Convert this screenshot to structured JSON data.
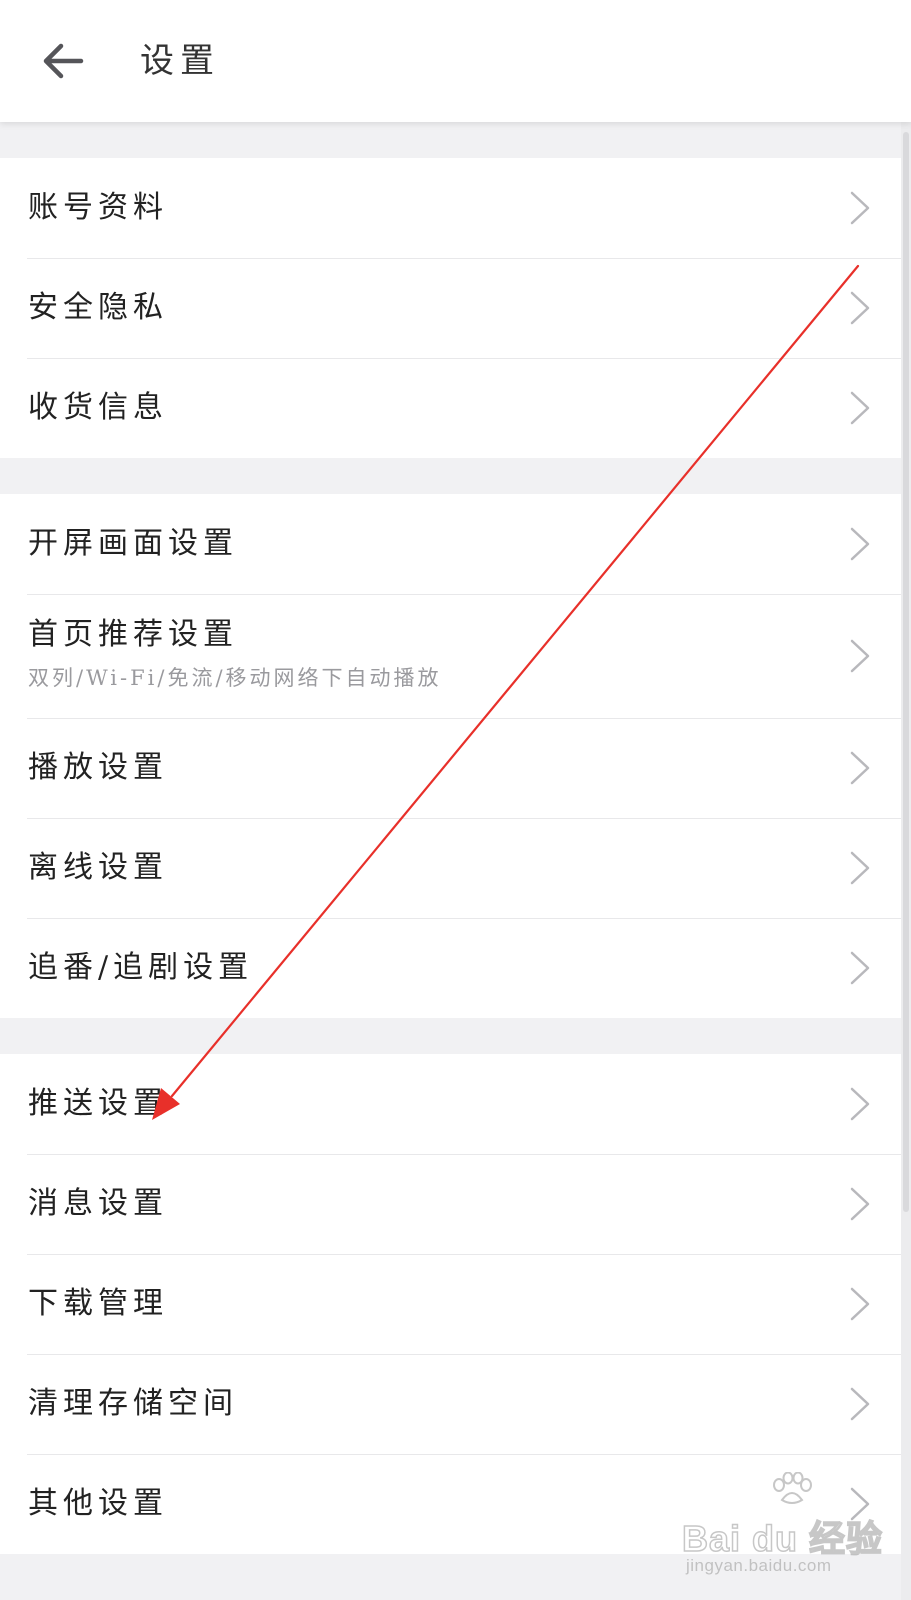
{
  "header": {
    "title": "设置"
  },
  "groups": [
    {
      "items": [
        {
          "label": "账号资料"
        },
        {
          "label": "安全隐私"
        },
        {
          "label": "收货信息"
        }
      ]
    },
    {
      "items": [
        {
          "label": "开屏画面设置"
        },
        {
          "label": "首页推荐设置",
          "sub": "双列/Wi-Fi/免流/移动网络下自动播放"
        },
        {
          "label": "播放设置"
        },
        {
          "label": "离线设置"
        },
        {
          "label": "追番/追剧设置"
        }
      ]
    },
    {
      "items": [
        {
          "label": "推送设置"
        },
        {
          "label": "消息设置"
        },
        {
          "label": "下载管理"
        },
        {
          "label": "清理存储空间"
        },
        {
          "label": "其他设置"
        }
      ]
    }
  ],
  "annotation": {
    "color": "#e8302a",
    "target": "推送设置"
  },
  "watermark": {
    "brand": "Bai du 经验",
    "url": "jingyan.baidu.com"
  },
  "colors": {
    "background": "#f1f1f3",
    "row": "#ffffff",
    "divider": "#e8e8ea",
    "chevron": "#b8b8bc",
    "subtext": "#9a9a9e"
  }
}
